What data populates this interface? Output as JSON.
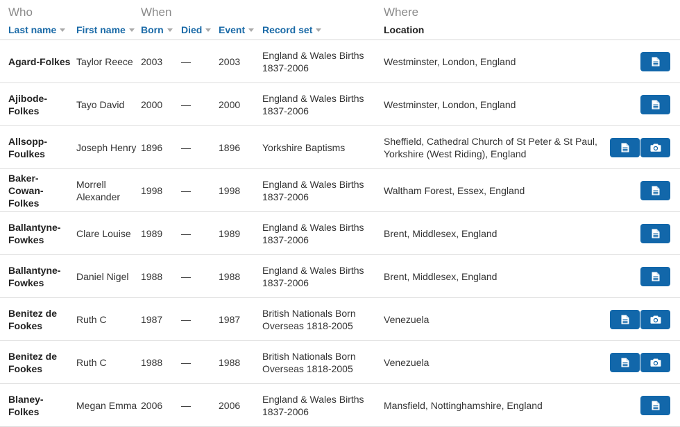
{
  "groups": {
    "who": "Who",
    "when": "When",
    "where": "Where"
  },
  "columns": {
    "last_name": "Last name",
    "first_name": "First name",
    "born": "Born",
    "died": "Died",
    "event": "Event",
    "record_set": "Record set",
    "location": "Location"
  },
  "icons": {
    "transcript": "document-icon",
    "image": "camera-icon"
  },
  "colors": {
    "accent": "#1a6aa7",
    "button": "#1267aa"
  },
  "rows": [
    {
      "last": "Agard-Folkes",
      "first": "Taylor Reece",
      "born": "2003",
      "died": "—",
      "event": "2003",
      "record": "England & Wales Births 1837-2006",
      "location": "Westminster, London, England",
      "image": false
    },
    {
      "last": "Ajibode-Folkes",
      "first": "Tayo David",
      "born": "2000",
      "died": "—",
      "event": "2000",
      "record": "England & Wales Births 1837-2006",
      "location": "Westminster, London, England",
      "image": false
    },
    {
      "last": "Allsopp-Foulkes",
      "first": "Joseph Henry",
      "born": "1896",
      "died": "—",
      "event": "1896",
      "record": "Yorkshire Baptisms",
      "location": "Sheffield, Cathedral Church of St Peter & St Paul, Yorkshire (West Riding), England",
      "image": true
    },
    {
      "last": "Baker-Cowan-Folkes",
      "first": "Morrell Alexander",
      "born": "1998",
      "died": "—",
      "event": "1998",
      "record": "England & Wales Births 1837-2006",
      "location": "Waltham Forest, Essex, England",
      "image": false
    },
    {
      "last": "Ballantyne-Fowkes",
      "first": "Clare Louise",
      "born": "1989",
      "died": "—",
      "event": "1989",
      "record": "England & Wales Births 1837-2006",
      "location": "Brent, Middlesex, England",
      "image": false
    },
    {
      "last": "Ballantyne-Fowkes",
      "first": "Daniel Nigel",
      "born": "1988",
      "died": "—",
      "event": "1988",
      "record": "England & Wales Births 1837-2006",
      "location": "Brent, Middlesex, England",
      "image": false
    },
    {
      "last": "Benitez de Fookes",
      "first": "Ruth C",
      "born": "1987",
      "died": "—",
      "event": "1987",
      "record": "British Nationals Born Overseas 1818-2005",
      "location": "Venezuela",
      "image": true
    },
    {
      "last": "Benitez de Fookes",
      "first": "Ruth C",
      "born": "1988",
      "died": "—",
      "event": "1988",
      "record": "British Nationals Born Overseas 1818-2005",
      "location": "Venezuela",
      "image": true
    },
    {
      "last": "Blaney-Folkes",
      "first": "Megan Emma",
      "born": "2006",
      "died": "—",
      "event": "2006",
      "record": "England & Wales Births 1837-2006",
      "location": "Mansfield, Nottinghamshire, England",
      "image": false
    }
  ]
}
